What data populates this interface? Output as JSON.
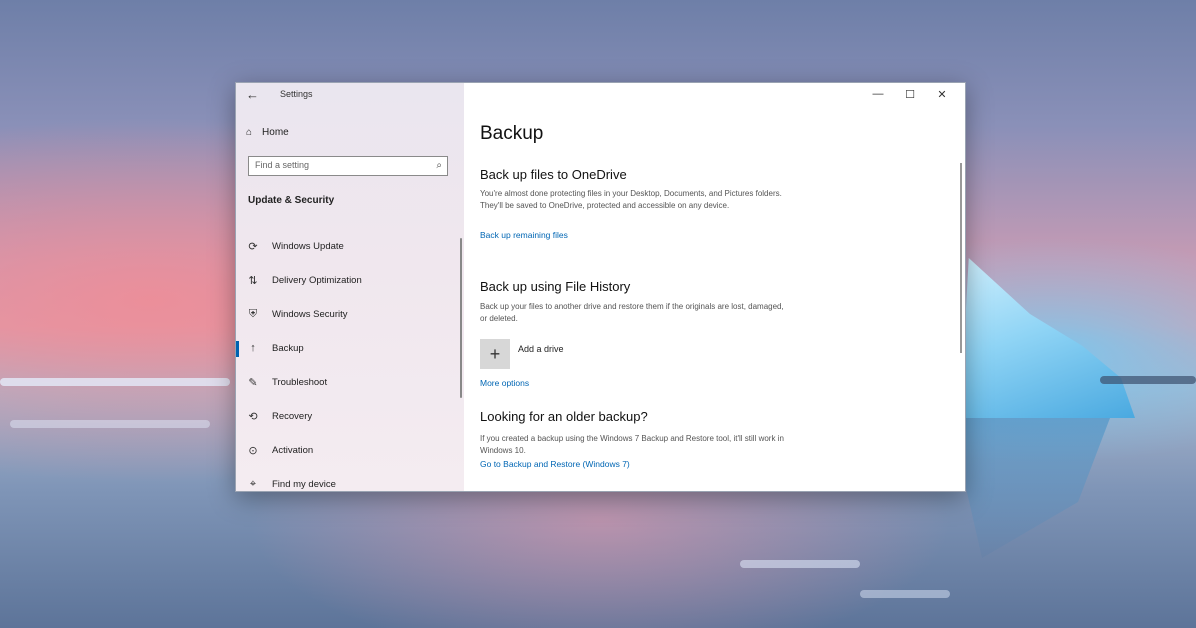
{
  "window": {
    "title": "Settings",
    "back_glyph": "←",
    "controls": {
      "minimize": "—",
      "maximize": "☐",
      "close": "✕"
    }
  },
  "sidebar": {
    "home_label": "Home",
    "search_placeholder": "Find a setting",
    "section_title": "Update & Security",
    "items": [
      {
        "label": "Windows Update",
        "icon": "refresh-icon",
        "glyph": "⟳"
      },
      {
        "label": "Delivery Optimization",
        "icon": "delivery-optimization-icon",
        "glyph": "⇅"
      },
      {
        "label": "Windows Security",
        "icon": "shield-icon",
        "glyph": "⛨"
      },
      {
        "label": "Backup",
        "icon": "backup-icon",
        "glyph": "↑",
        "active": true
      },
      {
        "label": "Troubleshoot",
        "icon": "wrench-icon",
        "glyph": "✎"
      },
      {
        "label": "Recovery",
        "icon": "recovery-icon",
        "glyph": "⟲"
      },
      {
        "label": "Activation",
        "icon": "activation-icon",
        "glyph": "⊙"
      },
      {
        "label": "Find my device",
        "icon": "find-device-icon",
        "glyph": "⌖"
      }
    ]
  },
  "main": {
    "title": "Backup",
    "onedrive": {
      "heading": "Back up files to OneDrive",
      "description": "You're almost done protecting files in your Desktop, Documents, and Pictures folders. They'll be saved to OneDrive, protected and accessible on any device.",
      "link": "Back up remaining files"
    },
    "file_history": {
      "heading": "Back up using File History",
      "description": "Back up your files to another drive and restore them if the originals are lost, damaged, or deleted.",
      "add_drive_label": "Add a drive",
      "add_glyph": "+",
      "more_options": "More options"
    },
    "older_backup": {
      "heading": "Looking for an older backup?",
      "description": "If you created a backup using the Windows 7 Backup and Restore tool, it'll still work in Windows 10.",
      "link": "Go to Backup and Restore (Windows 7)"
    }
  },
  "colors": {
    "accent": "#0063b1",
    "link": "#0066b4"
  }
}
